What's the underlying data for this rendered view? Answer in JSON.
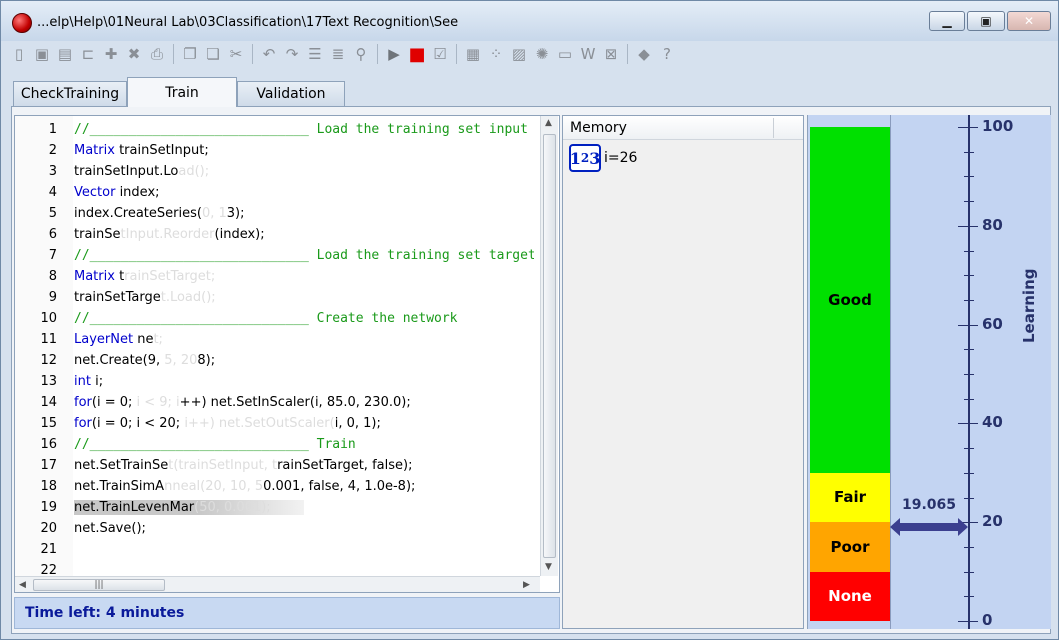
{
  "window": {
    "title": "...elp\\Help\\01Neural Lab\\03Classification\\17Text Recognition\\See",
    "minimize_label": "▁",
    "maximize_label": "▣",
    "close_label": "✕"
  },
  "toolbar": {
    "icons": [
      "new-file-icon",
      "save-icon",
      "save-as-icon",
      "open-folder-icon",
      "add-icon",
      "delete-icon",
      "print-icon",
      "copy-icon",
      "paste-icon",
      "cut-icon",
      "undo-icon",
      "redo-icon",
      "align-icon",
      "indent-icon",
      "debug-icon",
      "run-icon",
      "stop-icon",
      "check-icon",
      "chart-icon",
      "network-icon",
      "pattern-icon",
      "lightbulb-icon",
      "message-icon",
      "web-icon",
      "image-icon",
      "erase-icon",
      "help-icon"
    ]
  },
  "tabs": [
    {
      "label": "CheckTraining"
    },
    {
      "label": "Train"
    },
    {
      "label": "Validation"
    }
  ],
  "editor": {
    "lines": [
      {
        "n": "1",
        "text": "//____________________________ Load the training set input"
      },
      {
        "n": "2",
        "kw": "Matrix",
        "text": " trainSetInput;"
      },
      {
        "n": "3",
        "text": "trainSetInput.Lo",
        "hidden": "ad();"
      },
      {
        "n": "4",
        "kw": "Vector",
        "text": " index;"
      },
      {
        "n": "5",
        "text": "index.CreateSeries(",
        "hidden": "0, 1",
        "tail": "3);"
      },
      {
        "n": "6",
        "text": "trainSe",
        "hidden": "tInput.Reorder",
        "tail": "(index);"
      },
      {
        "n": "7",
        "text": "//____________________________ Load the training set target"
      },
      {
        "n": "8",
        "kw": "Matrix",
        "text": " t",
        "hidden": "rainSetTarget;"
      },
      {
        "n": "9",
        "text": "trainSetTarge",
        "hidden": "t.Load();"
      },
      {
        "n": "10",
        "text": "//____________________________ Create the network"
      },
      {
        "n": "11",
        "kw": "LayerNet",
        "text": " ne",
        "hidden": "t;"
      },
      {
        "n": "12",
        "text": "net.Create(9, ",
        "hidden": "5, 20",
        "tail": "8);"
      },
      {
        "n": "13",
        "kw": "int",
        "text": " i;"
      },
      {
        "n": "14",
        "kw": "for",
        "text": "(i = 0; ",
        "hidden": "i < 9; i",
        "tail": "++) net.SetInScaler(i, 85.0, 230.0);"
      },
      {
        "n": "15",
        "kw": "for",
        "text": "(i = 0; i < 20; ",
        "hidden": "i++) net.SetOutScaler(",
        "tail": "i, 0, 1);"
      },
      {
        "n": "16",
        "text": "//____________________________ Train"
      },
      {
        "n": "17",
        "text": "net.SetTrainSe",
        "hidden": "t(trainSetInput, t",
        "tail": "rainSetTarget, false);"
      },
      {
        "n": "18",
        "text": "net.TrainSimA",
        "hidden": "nneal(20, 10, 5",
        "tail": "0.001, false, 4, 1.0e-8);"
      },
      {
        "n": "19",
        "text": "net.TrainLevenMar",
        "hidden": "(50, 0.001);"
      },
      {
        "n": "20",
        "text": "net.Save();"
      },
      {
        "n": "21",
        "text": ""
      },
      {
        "n": "22",
        "text": ""
      }
    ]
  },
  "status": {
    "text": "Time left: 4 minutes"
  },
  "memory": {
    "header": "Memory",
    "items": [
      {
        "icon": "integer-variable-icon",
        "value": "i=26"
      }
    ]
  },
  "gauge": {
    "bands": [
      {
        "label": "Good",
        "color": "#00e000",
        "from": 30,
        "to": 100
      },
      {
        "label": "Fair",
        "color": "#ffff00",
        "from": 20,
        "to": 30
      },
      {
        "label": "Poor",
        "color": "#ffa500",
        "from": 10,
        "to": 20
      },
      {
        "label": "None",
        "color": "#ff0000",
        "from": 0,
        "to": 10
      }
    ],
    "ticks": [
      "100",
      "80",
      "60",
      "40",
      "20",
      "0"
    ],
    "axis_title": "Learning",
    "value": 19.065,
    "value_label": "19.065"
  }
}
